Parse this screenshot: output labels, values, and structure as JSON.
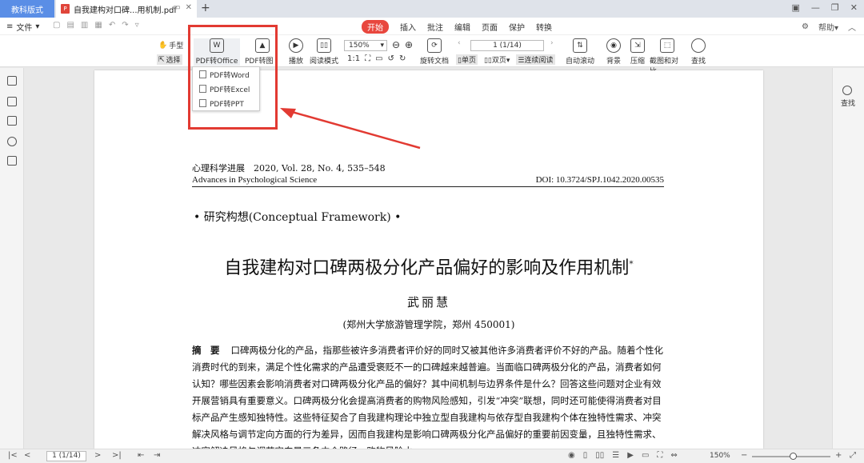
{
  "tabs": {
    "brand": "教科版式",
    "document": "自我建构对口碑...用机制.pdf",
    "pdf_badge": "P"
  },
  "menu": {
    "file": "文件",
    "items": [
      "开始",
      "插入",
      "批注",
      "编辑",
      "页面",
      "保护",
      "转换"
    ],
    "active": "开始",
    "help": "帮助"
  },
  "toolbar": {
    "hand": "手型",
    "select": "选择",
    "pdf_to_office": "PDF转Office",
    "pdf_to_image": "PDF转图片",
    "play": "播放",
    "read_mode": "阅读模式",
    "zoom": "150%",
    "rotate": "旋转文档",
    "page": "1 (1/14)",
    "single": "单页",
    "double": "双页",
    "continuous": "连续阅读",
    "auto_scroll": "自动滚动",
    "background": "背景",
    "compress": "压缩",
    "screenshot": "截图和对比",
    "find": "查找"
  },
  "dropdown": {
    "items": [
      "PDF转Word",
      "PDF转Excel",
      "PDF转PPT"
    ]
  },
  "right_panel": {
    "search": "查找"
  },
  "page": {
    "journal_cn": "心理科学进展　2020, Vol. 28, No. 4, 535–548",
    "journal_en": "Advances in Psychological Science",
    "doi": "DOI: 10.3724/SPJ.1042.2020.00535",
    "section": "• 研究构想(Conceptual Framework) •",
    "title": "自我建构对口碑两极分化产品偏好的影响及作用机制",
    "title_mark": "*",
    "author": "武丽慧",
    "affiliation": "(郑州大学旅游管理学院，郑州 450001)",
    "abstract_label": "摘　要",
    "abstract_text": "口碑两极分化的产品，指那些被许多消费者评价好的同时又被其他许多消费者评价不好的产品。随着个性化消费时代的到来，满足个性化需求的产品遭受褒贬不一的口碑越来越普遍。当面临口碑两极分化的产品，消费者如何认知？哪些因素会影响消费者对口碑两极分化产品的偏好？其中间机制与边界条件是什么？回答这些问题对企业有效开展营销具有重要意义。口碑两极分化会提高消费者的购物风险感知，引发“冲突”联想，同时还可能使得消费者对目标产品产生感知独特性。这些特征契合了自我建构理论中独立型自我建构与依存型自我建构个体在独特性需求、冲突解决风格与调节定向方面的行为差异，因而自我建构是影响口碑两极分化产品偏好的重要前因变量，且独特性需求、冲突解决风格与调节定向是三条中介路径，购物风险水"
  },
  "status": {
    "page": "1 (1/14)",
    "zoom": "150%"
  }
}
